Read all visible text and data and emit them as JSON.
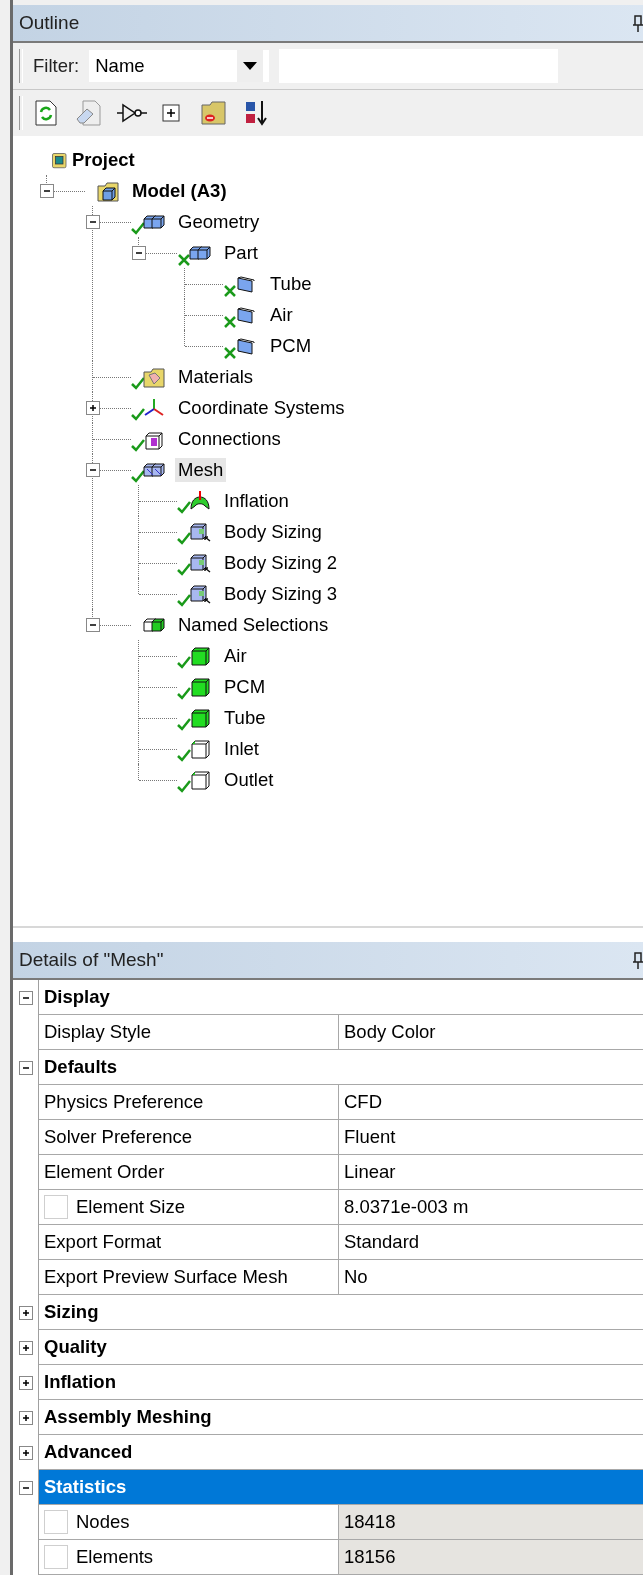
{
  "outline": {
    "title": "Outline",
    "filter": {
      "label": "Filter:",
      "value": "Name"
    },
    "tree": [
      {
        "label": "Project",
        "bold": true,
        "kind": "project",
        "checked": false,
        "selected": false,
        "children": [
          {
            "label": "Model (A3)",
            "bold": true,
            "kind": "model",
            "checked": false,
            "expanded": true,
            "selected": false,
            "children": [
              {
                "label": "Geometry",
                "bold": false,
                "kind": "geometry",
                "checked": true,
                "crossed": false,
                "expanded": true,
                "selected": false,
                "children": [
                  {
                    "label": "Part",
                    "bold": false,
                    "kind": "geometry",
                    "checked": true,
                    "crossed": true,
                    "expanded": true,
                    "selected": false,
                    "children": [
                      {
                        "label": "Tube",
                        "bold": false,
                        "kind": "body",
                        "checked": true,
                        "crossed": true,
                        "selected": false
                      },
                      {
                        "label": "Air",
                        "bold": false,
                        "kind": "body",
                        "checked": true,
                        "crossed": true,
                        "selected": false
                      },
                      {
                        "label": "PCM",
                        "bold": false,
                        "kind": "body",
                        "checked": true,
                        "crossed": true,
                        "selected": false
                      }
                    ]
                  }
                ]
              },
              {
                "label": "Materials",
                "bold": false,
                "kind": "materials",
                "checked": true,
                "crossed": false,
                "selected": false
              },
              {
                "label": "Coordinate Systems",
                "bold": false,
                "kind": "coordinates",
                "checked": true,
                "crossed": false,
                "expanded": false,
                "selected": false
              },
              {
                "label": "Connections",
                "bold": false,
                "kind": "connections",
                "checked": true,
                "crossed": false,
                "selected": false
              },
              {
                "label": "Mesh",
                "bold": false,
                "kind": "mesh",
                "checked": true,
                "crossed": false,
                "expanded": true,
                "selected": true,
                "children": [
                  {
                    "label": "Inflation",
                    "bold": false,
                    "kind": "inflation",
                    "checked": true,
                    "crossed": false,
                    "selected": false
                  },
                  {
                    "label": "Body Sizing",
                    "bold": false,
                    "kind": "sizing",
                    "checked": true,
                    "crossed": false,
                    "selected": false
                  },
                  {
                    "label": "Body Sizing 2",
                    "bold": false,
                    "kind": "sizing",
                    "checked": true,
                    "crossed": false,
                    "selected": false
                  },
                  {
                    "label": "Body Sizing 3",
                    "bold": false,
                    "kind": "sizing",
                    "checked": true,
                    "crossed": false,
                    "selected": false
                  }
                ]
              },
              {
                "label": "Named Selections",
                "bold": false,
                "kind": "named-selections",
                "checked": false,
                "expanded": true,
                "selected": false,
                "children": [
                  {
                    "label": "Air",
                    "bold": false,
                    "kind": "named-solid",
                    "checked": true,
                    "crossed": false,
                    "selected": false
                  },
                  {
                    "label": "PCM",
                    "bold": false,
                    "kind": "named-solid",
                    "checked": true,
                    "crossed": false,
                    "selected": false
                  },
                  {
                    "label": "Tube",
                    "bold": false,
                    "kind": "named-solid",
                    "checked": true,
                    "crossed": false,
                    "selected": false
                  },
                  {
                    "label": "Inlet",
                    "bold": false,
                    "kind": "named-empty",
                    "checked": true,
                    "crossed": false,
                    "selected": false
                  },
                  {
                    "label": "Outlet",
                    "bold": false,
                    "kind": "named-empty",
                    "checked": true,
                    "crossed": false,
                    "selected": false
                  }
                ]
              }
            ]
          }
        ]
      }
    ]
  },
  "details": {
    "title": "Details of \"Mesh\"",
    "rows": [
      {
        "kind": "group",
        "label": "Display",
        "expanded": true,
        "selected": false
      },
      {
        "kind": "property",
        "name": "Display Style",
        "value": "Body Color",
        "readonly": false,
        "selected": false
      },
      {
        "kind": "group",
        "label": "Defaults",
        "expanded": true,
        "selected": false
      },
      {
        "kind": "property",
        "name": "Physics Preference",
        "value": "CFD",
        "readonly": false,
        "selected": false
      },
      {
        "kind": "property",
        "name": "Solver Preference",
        "value": "Fluent",
        "readonly": false,
        "selected": false
      },
      {
        "kind": "property",
        "name": "Element Order",
        "value": "Linear",
        "readonly": false,
        "selected": false
      },
      {
        "kind": "parameter",
        "name": "Element Size",
        "value": "8.0371e-003 m",
        "checked": false,
        "readonly": false,
        "selected": false
      },
      {
        "kind": "property",
        "name": "Export Format",
        "value": "Standard",
        "readonly": false,
        "selected": false
      },
      {
        "kind": "property",
        "name": "Export Preview Surface Mesh",
        "value": "No",
        "readonly": false,
        "selected": false
      },
      {
        "kind": "group",
        "label": "Sizing",
        "expanded": false,
        "selected": false
      },
      {
        "kind": "group",
        "label": "Quality",
        "expanded": false,
        "selected": false
      },
      {
        "kind": "group",
        "label": "Inflation",
        "expanded": false,
        "selected": false
      },
      {
        "kind": "group",
        "label": "Assembly Meshing",
        "expanded": false,
        "selected": false
      },
      {
        "kind": "group",
        "label": "Advanced",
        "expanded": false,
        "selected": false
      },
      {
        "kind": "group",
        "label": "Statistics",
        "expanded": true,
        "selected": true
      },
      {
        "kind": "parameter",
        "name": "Nodes",
        "value": "18418",
        "checked": false,
        "readonly": true,
        "selected": false
      },
      {
        "kind": "parameter",
        "name": "Elements",
        "value": "18156",
        "checked": false,
        "readonly": true,
        "selected": false
      }
    ]
  }
}
